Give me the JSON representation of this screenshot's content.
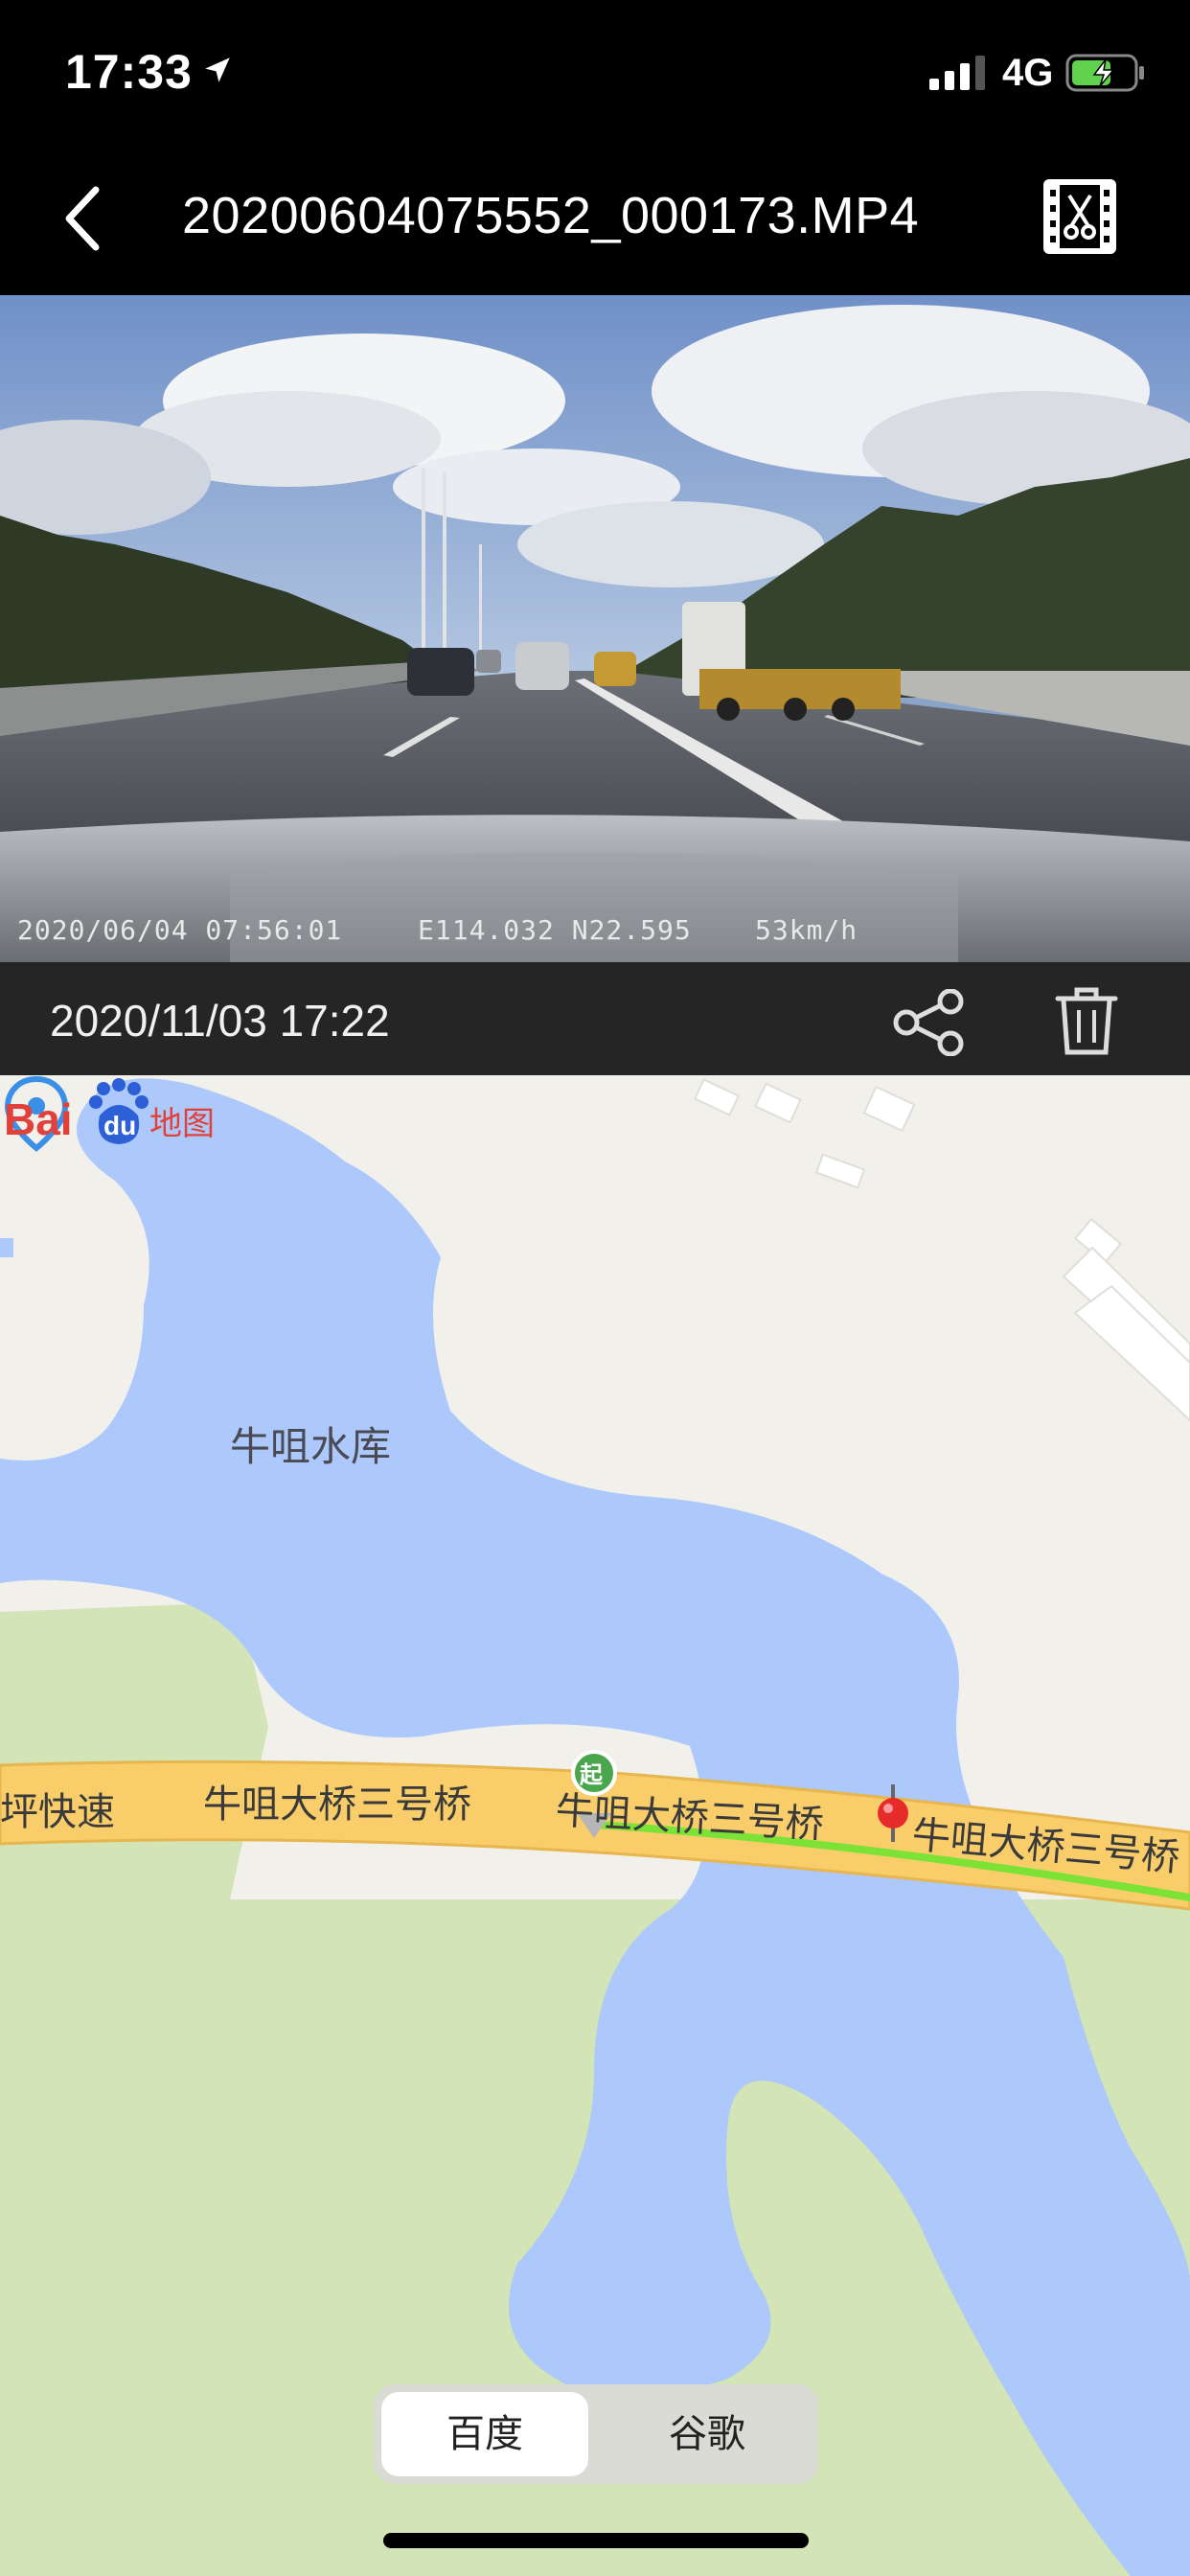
{
  "status_bar": {
    "time": "17:33",
    "network": "4G",
    "icons": [
      "location-arrow-icon",
      "signal-icon",
      "battery-charging-icon"
    ]
  },
  "nav": {
    "title": "20200604075552_000173.MP4",
    "back_icon": "chevron-left-icon",
    "edit_icon": "film-scissors-icon"
  },
  "video": {
    "osd_date": "2020/06/04 07:56:01",
    "osd_coords": "E114.032 N22.595",
    "osd_speed": "53km/h"
  },
  "info_bar": {
    "date": "2020/11/03 17:22",
    "share_icon": "share-icon",
    "delete_icon": "trash-icon"
  },
  "map": {
    "reservoir_label": "牛咀水库",
    "road_label_left": "坪快速",
    "road_label_mid": "牛咀大桥三号桥",
    "road_label_route": "牛咀大桥三号桥",
    "road_label_right": "牛咀大桥三号桥",
    "start_marker": "起",
    "provider_tabs": [
      "百度",
      "谷歌"
    ],
    "active_tab": "百度",
    "logo_text": "Baidu地图",
    "colors": {
      "water": "#adc8fa",
      "green": "#d3e4b6",
      "road": "#f8cd6a",
      "route": "#7ce336",
      "land": "#f1f0ea"
    }
  }
}
